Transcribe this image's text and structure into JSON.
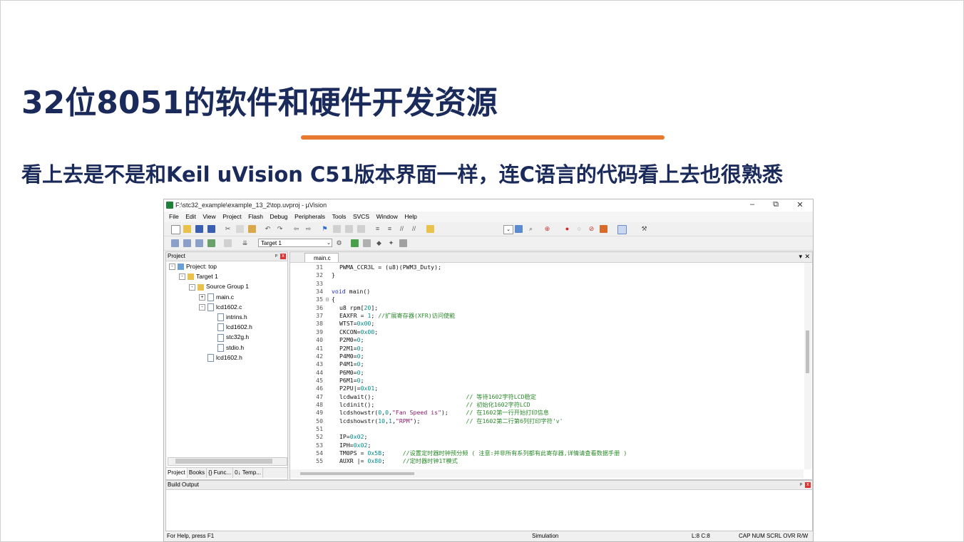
{
  "slide": {
    "title": "32位8051的软件和硬件开发资源",
    "subtitle": "看上去是不是和Keil uVision C51版本界面一样，连C语言的代码看上去也很熟悉"
  },
  "window": {
    "title": "F:\\stc32_example\\example_13_2\\top.uvproj - µVision",
    "minimize": "–",
    "restore": "⧉",
    "close": "✕"
  },
  "menu": [
    "File",
    "Edit",
    "View",
    "Project",
    "Flash",
    "Debug",
    "Peripherals",
    "Tools",
    "SVCS",
    "Window",
    "Help"
  ],
  "toolbar": {
    "target": "Target 1"
  },
  "project_panel": {
    "title": "Project",
    "pin": "ᵖ",
    "close": "x",
    "tree": [
      {
        "label": "Project: top",
        "indent": 0,
        "exp": "-",
        "icon": "proj"
      },
      {
        "label": "Target 1",
        "indent": 1,
        "exp": "-",
        "icon": "folder"
      },
      {
        "label": "Source Group 1",
        "indent": 2,
        "exp": "-",
        "icon": "folder"
      },
      {
        "label": "main.c",
        "indent": 3,
        "exp": "+",
        "icon": "file"
      },
      {
        "label": "lcd1602.c",
        "indent": 3,
        "exp": "-",
        "icon": "file"
      },
      {
        "label": "intrins.h",
        "indent": 4,
        "exp": "",
        "icon": "file"
      },
      {
        "label": "lcd1602.h",
        "indent": 4,
        "exp": "",
        "icon": "file"
      },
      {
        "label": "stc32g.h",
        "indent": 4,
        "exp": "",
        "icon": "file"
      },
      {
        "label": "stdio.h",
        "indent": 4,
        "exp": "",
        "icon": "file"
      },
      {
        "label": "lcd1602.h",
        "indent": 3,
        "exp": "",
        "icon": "file"
      }
    ],
    "tabs": [
      "Project",
      "Books",
      "{} Func...",
      "0↓ Temp..."
    ]
  },
  "editor": {
    "tab": "main.c",
    "lines": [
      {
        "n": "31",
        "f": "",
        "code": "PWMA_CCR3L = (u8)(PWM3_Duty);",
        "indent": 1
      },
      {
        "n": "32",
        "f": "",
        "code": "}",
        "indent": 0
      },
      {
        "n": "33",
        "f": "",
        "code": "",
        "indent": 0
      },
      {
        "n": "34",
        "f": "",
        "code": "void main()",
        "indent": 0,
        "kw": "void"
      },
      {
        "n": "35",
        "f": "⊟",
        "code": "{",
        "indent": 0
      },
      {
        "n": "36",
        "f": "",
        "code": "u8 rpm[20];",
        "indent": 1
      },
      {
        "n": "37",
        "f": "",
        "code": "EAXFR = 1; //扩展寄存器(XFR)访问使能",
        "indent": 1
      },
      {
        "n": "38",
        "f": "",
        "code": "WTST=0x00;",
        "indent": 1
      },
      {
        "n": "39",
        "f": "",
        "code": "CKCON=0x00;",
        "indent": 1
      },
      {
        "n": "40",
        "f": "",
        "code": "P2M0=0;",
        "indent": 1
      },
      {
        "n": "41",
        "f": "",
        "code": "P2M1=0;",
        "indent": 1
      },
      {
        "n": "42",
        "f": "",
        "code": "P4M0=0;",
        "indent": 1
      },
      {
        "n": "43",
        "f": "",
        "code": "P4M1=0;",
        "indent": 1
      },
      {
        "n": "44",
        "f": "",
        "code": "P6M0=0;",
        "indent": 1
      },
      {
        "n": "45",
        "f": "",
        "code": "P6M1=0;",
        "indent": 1
      },
      {
        "n": "46",
        "f": "",
        "code": "P2PU|=0x01;",
        "indent": 1
      },
      {
        "n": "47",
        "f": "",
        "code": "lcdwait();                          // 等待1602字符LCD稳定",
        "indent": 1
      },
      {
        "n": "48",
        "f": "",
        "code": "lcdinit();                          // 初始化1602字符LCD",
        "indent": 1
      },
      {
        "n": "49",
        "f": "",
        "code": "lcdshowstr(0,0,\"Fan Speed is\");     // 在1602第一行开始打印信息",
        "indent": 1
      },
      {
        "n": "50",
        "f": "",
        "code": "lcdshowstr(10,1,\"RPM\");             // 在1602第二行第6列打印字符'v'",
        "indent": 1
      },
      {
        "n": "51",
        "f": "",
        "code": "",
        "indent": 0
      },
      {
        "n": "52",
        "f": "",
        "code": "IP=0x02;",
        "indent": 1
      },
      {
        "n": "53",
        "f": "",
        "code": "IPH=0x02;",
        "indent": 1
      },
      {
        "n": "54",
        "f": "",
        "code": "TM0PS = 0x5B;     //设置定时器时钟预分频 ( 注意:并非所有系列都有此寄存器,详情请查看数据手册 )",
        "indent": 1
      },
      {
        "n": "55",
        "f": "",
        "code": "AUXR |= 0x80;     //定时器时钟1T模式",
        "indent": 1
      }
    ]
  },
  "build_output": {
    "title": "Build Output"
  },
  "status": {
    "help": "For Help, press F1",
    "mode": "Simulation",
    "pos": "L:8 C:8",
    "flags": "CAP  NUM  SCRL  OVR  R/W"
  }
}
